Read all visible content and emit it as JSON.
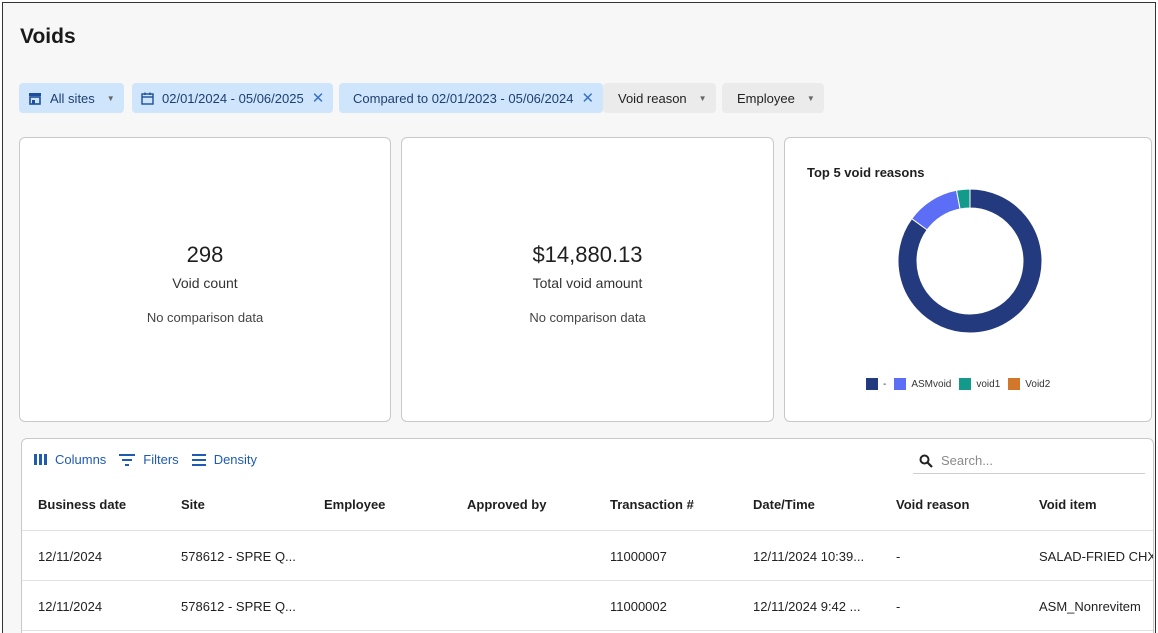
{
  "page": {
    "title": "Voids"
  },
  "filters": {
    "sites": "All sites",
    "date_range": "02/01/2024 - 05/06/2025",
    "compare": "Compared to 02/01/2023 - 05/06/2024",
    "void_reason": "Void reason",
    "employee": "Employee"
  },
  "kpis": {
    "count": {
      "value": "298",
      "label": "Void count",
      "comparison": "No comparison data"
    },
    "amount": {
      "value": "$14,880.13",
      "label": "Total void amount",
      "comparison": "No comparison data"
    }
  },
  "donut": {
    "title": "Top 5 void reasons",
    "legend": [
      {
        "label": "-",
        "color": "#233a7e"
      },
      {
        "label": "ASMvoid",
        "color": "#5b6ef5"
      },
      {
        "label": "void1",
        "color": "#149a8a"
      },
      {
        "label": "Void2",
        "color": "#d2762b"
      }
    ]
  },
  "chart_data": {
    "type": "pie",
    "title": "Top 5 void reasons",
    "categories": [
      "-",
      "ASMvoid",
      "void1",
      "Void2"
    ],
    "values": [
      85,
      12,
      3,
      0
    ],
    "colors": [
      "#233a7e",
      "#5b6ef5",
      "#149a8a",
      "#d2762b"
    ],
    "donut": true,
    "legend": "bottom"
  },
  "table": {
    "toolbar": {
      "columns": "Columns",
      "filters": "Filters",
      "density": "Density"
    },
    "search_placeholder": "Search...",
    "headers": [
      "Business date",
      "Site",
      "Employee",
      "Approved by",
      "Transaction #",
      "Date/Time",
      "Void reason",
      "Void item"
    ],
    "rows": [
      [
        "12/11/2024",
        "578612 - SPRE Q...",
        "",
        "",
        "11000007",
        "12/11/2024 10:39...",
        "-",
        "SALAD-FRIED CHX"
      ],
      [
        "12/11/2024",
        "578612 - SPRE Q...",
        "",
        "",
        "11000002",
        "12/11/2024 9:42 ...",
        "-",
        "ASM_Nonrevitem"
      ]
    ]
  }
}
